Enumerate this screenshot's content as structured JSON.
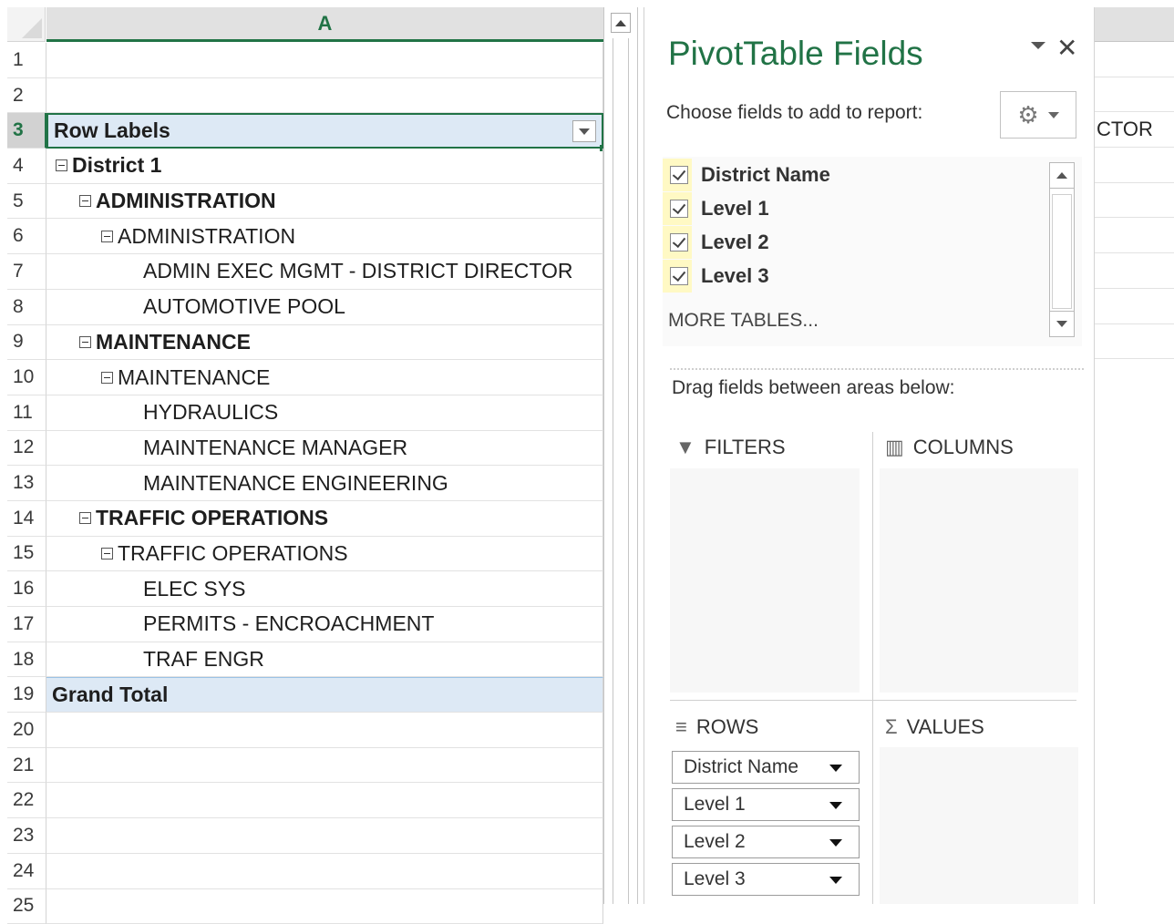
{
  "sheet": {
    "column_header": "A",
    "row_numbers": [
      "1",
      "2",
      "3",
      "4",
      "5",
      "6",
      "7",
      "8",
      "9",
      "10",
      "11",
      "12",
      "13",
      "14",
      "15",
      "16",
      "17",
      "18",
      "19",
      "20",
      "21",
      "22",
      "23",
      "24",
      "25"
    ],
    "rows": {
      "r1": "",
      "r2": "",
      "r3": "Row Labels",
      "r4": "District 1",
      "r5": "ADMINISTRATION",
      "r6": "ADMINISTRATION",
      "r7": "ADMIN EXEC MGMT - DISTRICT DIRECTOR",
      "r8": "AUTOMOTIVE POOL",
      "r9": "MAINTENANCE",
      "r10": "MAINTENANCE",
      "r11": "HYDRAULICS",
      "r12": "MAINTENANCE MANAGER",
      "r13": "MAINTENANCE ENGINEERING",
      "r14": "TRAFFIC OPERATIONS",
      "r15": "TRAFFIC OPERATIONS",
      "r16": "ELEC SYS",
      "r17": "PERMITS - ENCROACHMENT",
      "r18": "TRAF ENGR",
      "r19": "Grand Total"
    },
    "right_overflow_text": "CTOR"
  },
  "panel": {
    "title": "PivotTable Fields",
    "choose_label": "Choose fields to add to report:",
    "fields": [
      "District Name",
      "Level 1",
      "Level 2",
      "Level 3"
    ],
    "more_tables": "MORE TABLES...",
    "drag_label": "Drag fields between areas below:",
    "areas": {
      "filters": "FILTERS",
      "columns": "COLUMNS",
      "rows": "ROWS",
      "values": "VALUES"
    },
    "row_fields": [
      "District Name",
      "Level 1",
      "Level 2",
      "Level 3"
    ]
  },
  "icons": {
    "filter": "filter-icon",
    "columns": "columns-icon",
    "rows": "rows-icon",
    "values": "sigma-icon",
    "gear": "gear-icon",
    "close": "close-icon"
  },
  "colors": {
    "accent": "#217346",
    "highlight": "#dde9f5"
  }
}
